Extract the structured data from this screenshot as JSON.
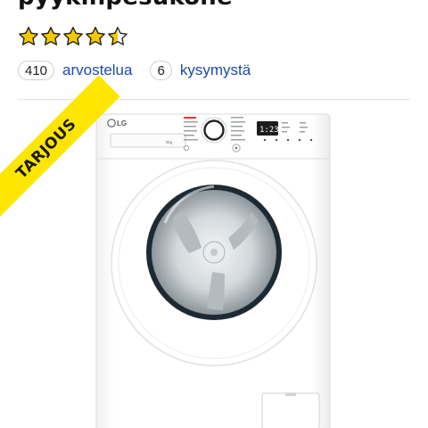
{
  "product": {
    "title": "pyykinpesukone",
    "rating": {
      "value": 4.5,
      "max": 5,
      "star_color": "#f5c800"
    },
    "reviews": {
      "count": "410",
      "label": "arvostelua"
    },
    "questions": {
      "count": "6",
      "label": "kysymystä"
    },
    "badge": {
      "label": "TARJOUS",
      "color": "#ffe600"
    },
    "image": {
      "brand": "LG",
      "capacity": "8kg",
      "display_time": "1:23"
    }
  },
  "colors": {
    "link": "#1d4aa8",
    "divider": "#e3e3e3"
  }
}
